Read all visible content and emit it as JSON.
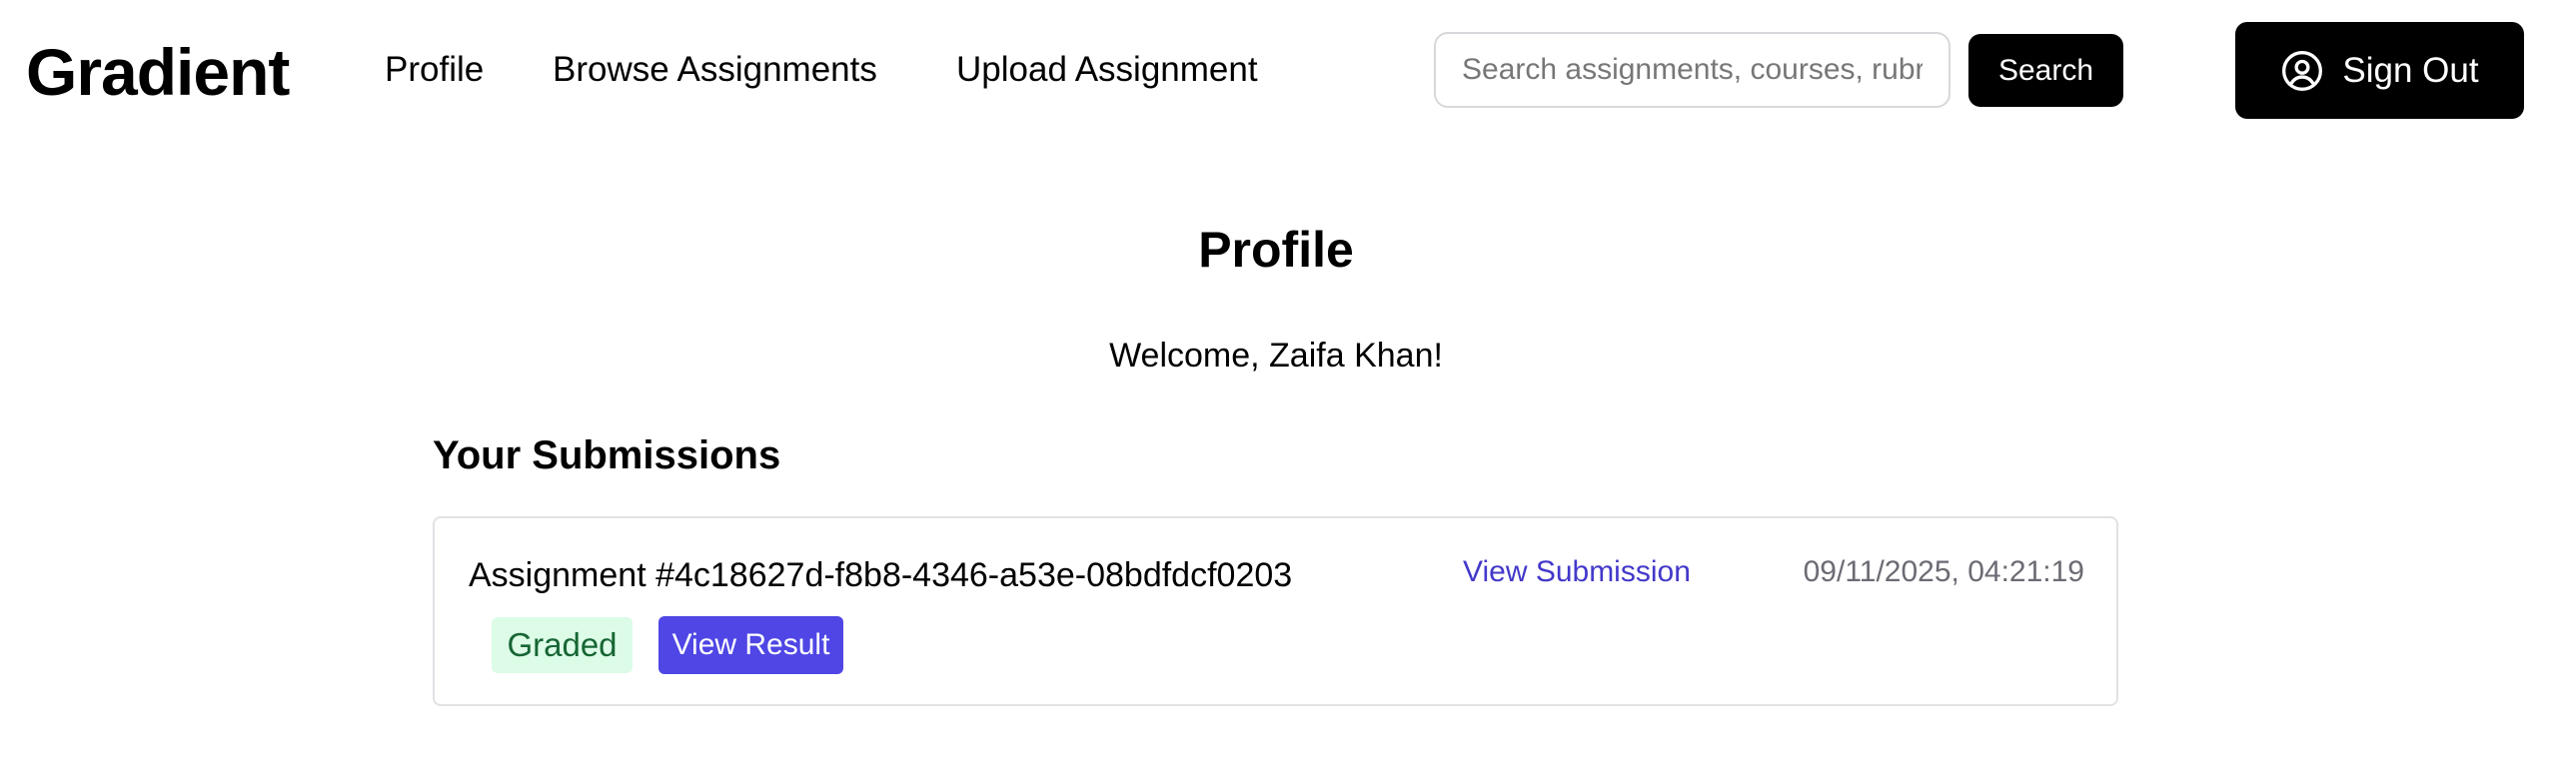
{
  "header": {
    "brand": "Gradient",
    "nav": {
      "profile": "Profile",
      "browse": "Browse Assignments",
      "upload": "Upload Assignment"
    },
    "search": {
      "placeholder": "Search assignments, courses, rubrics",
      "value": "",
      "button_label": "Search"
    },
    "sign_out": {
      "label": "Sign Out",
      "icon": "user-circle-icon"
    }
  },
  "main": {
    "title": "Profile",
    "welcome": "Welcome, Zaifa Khan!",
    "submissions_title": "Your Submissions",
    "submissions": [
      {
        "assignment": "Assignment #4c18627d-f8b8-4346-a53e-08bdfdcf0203",
        "view_submission": "View Submission",
        "timestamp": "09/11/2025, 04:21:19",
        "status": "Graded",
        "view_result": "View Result"
      }
    ]
  },
  "colors": {
    "primary": "#000000",
    "link": "#4338ca",
    "accent_button": "#4f46e5",
    "badge_bg": "#dcfce7",
    "badge_text": "#166534"
  }
}
